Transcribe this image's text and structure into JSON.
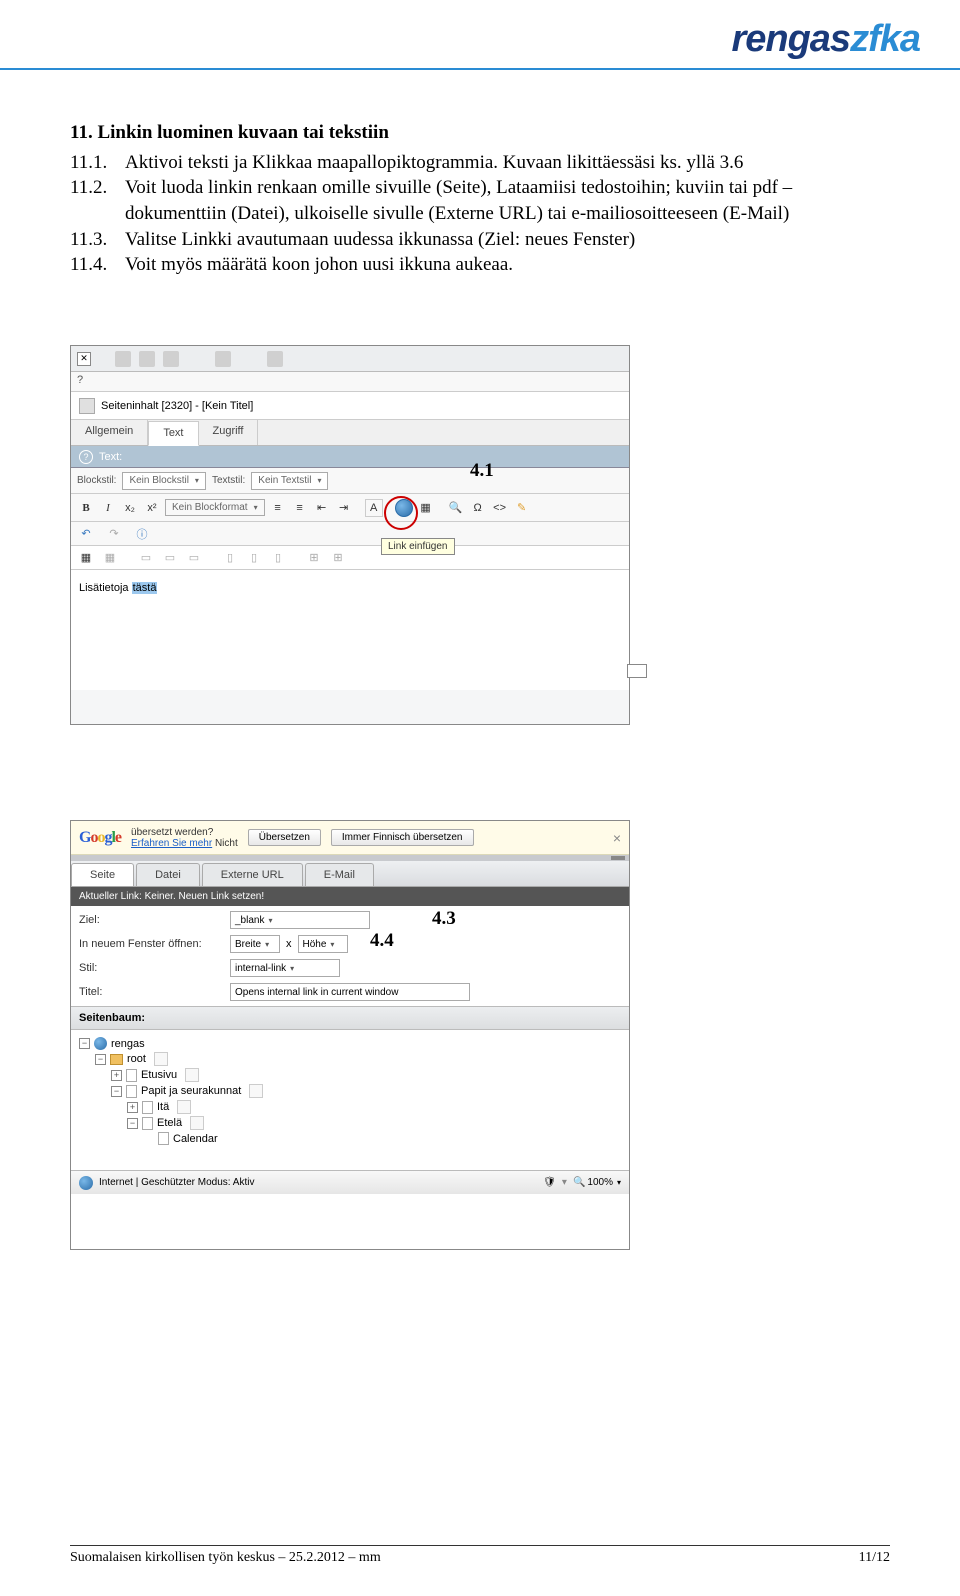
{
  "logo": {
    "part1": "rengas",
    "part2": "zfka"
  },
  "heading": "11. Linkin luominen kuvaan tai tekstiin",
  "items": [
    {
      "num": "11.1.",
      "text": "Aktivoi teksti ja Klikkaa maapallopiktogrammia. Kuvaan likittäessäsi ks. yllä 3.6"
    },
    {
      "num": "11.2.",
      "text": "Voit luoda linkin renkaan omille sivuille (Seite), Lataamiisi tedostoihin; kuviin tai pdf –dokumenttiin (Datei), ulkoiselle sivulle (Externe URL) tai e-mailiosoitteeseen (E-Mail)"
    },
    {
      "num": "11.3.",
      "text": "Valitse Linkki avautumaan uudessa ikkunassa (Ziel: neues Fenster)"
    },
    {
      "num": "11.4.",
      "text": "Voit myös määrätä koon johon uusi ikkuna aukeaa."
    }
  ],
  "ss1": {
    "help": "?",
    "title": "Seiteninhalt [2320] - [Kein Titel]",
    "tabs": [
      "Allgemein",
      "Text",
      "Zugriff"
    ],
    "textLabel": "Text:",
    "blockstil_label": "Blockstil:",
    "blockstil_value": "Kein Blockstil",
    "textstil_label": "Textstil:",
    "textstil_value": "Kein Textstil",
    "blockformat": "Kein Blockformat",
    "tooltip": "Link einfügen",
    "editor_prefix": "Lisätietoja ",
    "editor_highlight": "tästä"
  },
  "annot": {
    "a41": "4.1",
    "a43": "4.3",
    "a44": "4.4"
  },
  "ss2": {
    "google_text1": "übersetzt werden?",
    "google_link": "Erfahren Sie mehr",
    "google_nicht": "Nicht",
    "google_btn1": "Übersetzen",
    "google_btn2": "Immer Finnisch übersetzen",
    "tabs": [
      "Seite",
      "Datei",
      "Externe URL",
      "E-Mail"
    ],
    "darkbar": "Aktueller Link: Keiner. Neuen Link setzen!",
    "ziel_label": "Ziel:",
    "ziel_value": "_blank",
    "fenster_label": "In neuem Fenster öffnen:",
    "breite": "Breite",
    "hohe": "Höhe",
    "times": "x",
    "stil_label": "Stil:",
    "stil_value": "internal-link",
    "titel_label": "Titel:",
    "titel_value": "Opens internal link in current window",
    "tree_header": "Seitenbaum:",
    "tree": {
      "root": "rengas",
      "n1": "root",
      "n2": "Etusivu",
      "n3": "Papit ja seurakunnat",
      "n4": "Itä",
      "n5": "Etelä",
      "n6": "Calendar"
    },
    "status_text": "Internet | Geschützter Modus: Aktiv",
    "zoom": "100%"
  },
  "footer": {
    "left": "Suomalaisen kirkollisen työn keskus – 25.2.2012 – mm",
    "right": "11/12"
  }
}
